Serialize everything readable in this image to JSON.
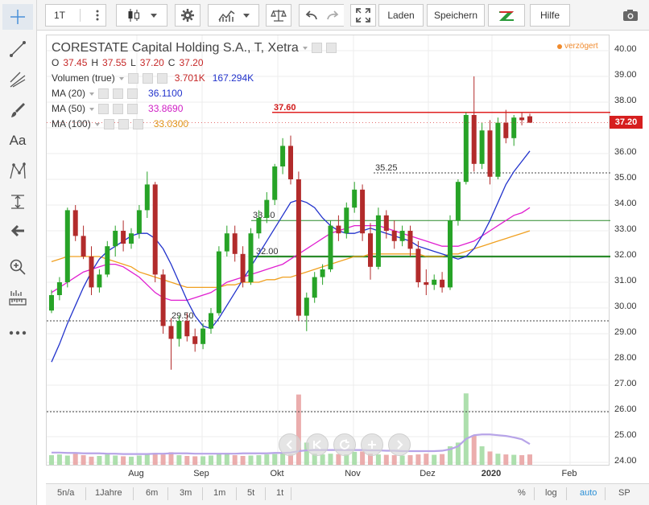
{
  "toolbar": {
    "interval": "1T",
    "load_label": "Laden",
    "save_label": "Speichern",
    "help_label": "Hilfe"
  },
  "legend": {
    "title": "CORESTATE Capital Holding S.A., T, Xetra",
    "o_label": "O",
    "o_value": "37.45",
    "h_label": "H",
    "h_value": "37.55",
    "l_label": "L",
    "l_value": "37.20",
    "c_label": "C",
    "c_value": "37.20",
    "volume_label": "Volumen (true)",
    "volume_v1": "3.701K",
    "volume_v2": "167.294K",
    "ma20_label": "MA (20)",
    "ma20_value": "36.1100",
    "ma50_label": "MA (50)",
    "ma50_value": "33.8690",
    "ma100_label": "MA (100)",
    "ma100_value": "33.0300",
    "delay": "verzögert"
  },
  "colors": {
    "up": "#27a327",
    "down": "#b22b2b",
    "ma20": "#2233cc",
    "ma50": "#e01fd0",
    "ma100": "#f0a020",
    "resistance": "#e02020",
    "support": "#2a8a2a",
    "vol_ma": "#b7a4e8"
  },
  "bottom": {
    "ranges": [
      "5n/a",
      "1Jahre",
      "6m",
      "3m",
      "1m",
      "5t",
      "1t"
    ],
    "percent": "%",
    "log": "log",
    "auto": "auto",
    "sp": "SP"
  },
  "chart_data": {
    "type": "candlestick",
    "yaxis": {
      "min": 24.0,
      "max": 40.0,
      "ticks": [
        "40.00",
        "39.00",
        "38.00",
        "37.00",
        "36.00",
        "35.00",
        "34.00",
        "33.00",
        "32.00",
        "31.00",
        "30.00",
        "29.00",
        "28.00",
        "27.00",
        "26.00",
        "25.00",
        "24.00"
      ]
    },
    "last_price": "37.20",
    "x_labels": [
      "Aug",
      "Sep",
      "Okt",
      "Nov",
      "Dez",
      "2020",
      "Feb"
    ],
    "candles": [
      [
        29.9,
        30.7,
        29.8,
        30.5
      ],
      [
        30.5,
        31.2,
        30.3,
        31.0
      ],
      [
        31.0,
        33.9,
        30.8,
        33.8
      ],
      [
        33.8,
        34.0,
        32.6,
        32.8
      ],
      [
        32.8,
        33.2,
        31.9,
        32.0
      ],
      [
        32.0,
        32.4,
        30.5,
        30.8
      ],
      [
        30.8,
        31.5,
        30.6,
        31.3
      ],
      [
        31.3,
        32.6,
        31.2,
        32.4
      ],
      [
        32.4,
        33.2,
        32.0,
        33.0
      ],
      [
        33.0,
        33.4,
        32.2,
        32.5
      ],
      [
        32.5,
        33.1,
        32.3,
        32.9
      ],
      [
        32.9,
        34.0,
        32.7,
        33.8
      ],
      [
        33.8,
        35.3,
        33.5,
        34.8
      ],
      [
        34.8,
        34.9,
        31.0,
        31.3
      ],
      [
        31.3,
        31.5,
        29.0,
        29.3
      ],
      [
        29.3,
        29.6,
        27.6,
        28.8
      ],
      [
        28.8,
        29.7,
        28.5,
        29.5
      ],
      [
        29.5,
        29.8,
        28.7,
        28.9
      ],
      [
        28.9,
        29.2,
        28.3,
        28.6
      ],
      [
        28.6,
        29.4,
        28.4,
        29.2
      ],
      [
        29.2,
        30.0,
        29.0,
        29.8
      ],
      [
        29.8,
        32.4,
        29.7,
        32.2
      ],
      [
        32.2,
        33.2,
        32.0,
        32.9
      ],
      [
        32.9,
        33.2,
        31.8,
        32.1
      ],
      [
        32.1,
        32.4,
        30.8,
        31.0
      ],
      [
        31.0,
        33.1,
        30.9,
        32.9
      ],
      [
        32.9,
        33.8,
        32.7,
        33.5
      ],
      [
        33.5,
        34.5,
        33.3,
        34.2
      ],
      [
        34.2,
        35.6,
        34.0,
        35.5
      ],
      [
        35.5,
        36.6,
        35.2,
        36.3
      ],
      [
        36.3,
        36.7,
        34.8,
        35.0
      ],
      [
        35.0,
        35.3,
        29.5,
        29.7
      ],
      [
        29.7,
        30.6,
        29.1,
        30.4
      ],
      [
        30.4,
        31.4,
        30.2,
        31.2
      ],
      [
        31.2,
        31.7,
        30.9,
        31.5
      ],
      [
        31.5,
        33.4,
        31.4,
        33.2
      ],
      [
        33.2,
        33.6,
        32.6,
        32.9
      ],
      [
        32.9,
        34.1,
        32.7,
        33.9
      ],
      [
        33.9,
        34.9,
        33.7,
        34.6
      ],
      [
        34.6,
        34.8,
        32.6,
        32.9
      ],
      [
        32.9,
        33.3,
        31.1,
        31.6
      ],
      [
        31.6,
        33.9,
        31.5,
        33.6
      ],
      [
        33.6,
        33.8,
        32.7,
        33.0
      ],
      [
        33.0,
        33.4,
        32.3,
        32.6
      ],
      [
        32.6,
        33.2,
        32.4,
        33.0
      ],
      [
        33.0,
        33.2,
        32.0,
        32.3
      ],
      [
        32.3,
        32.6,
        30.8,
        31.0
      ],
      [
        31.0,
        31.5,
        30.5,
        30.9
      ],
      [
        30.9,
        31.3,
        30.7,
        31.1
      ],
      [
        31.1,
        31.4,
        30.6,
        30.8
      ],
      [
        30.8,
        33.6,
        30.7,
        33.4
      ],
      [
        33.4,
        35.0,
        33.2,
        34.9
      ],
      [
        34.9,
        37.6,
        34.8,
        37.5
      ],
      [
        37.5,
        39.0,
        35.3,
        35.6
      ],
      [
        35.6,
        37.2,
        35.4,
        36.9
      ],
      [
        36.9,
        37.3,
        34.8,
        35.1
      ],
      [
        35.1,
        37.4,
        35.0,
        37.2
      ],
      [
        37.2,
        37.7,
        36.4,
        36.6
      ],
      [
        36.6,
        37.5,
        36.3,
        37.4
      ],
      [
        37.4,
        37.6,
        37.1,
        37.3
      ],
      [
        37.45,
        37.55,
        37.2,
        37.2
      ]
    ],
    "ma20": [
      27.9,
      28.6,
      29.4,
      30.1,
      30.8,
      31.4,
      31.9,
      32.2,
      32.4,
      32.6,
      32.8,
      32.9,
      32.9,
      32.7,
      32.3,
      31.7,
      31.0,
      30.3,
      29.7,
      29.3,
      29.2,
      29.6,
      30.1,
      30.6,
      31.1,
      31.6,
      32.1,
      32.6,
      33.1,
      33.6,
      34.1,
      34.2,
      34.1,
      33.9,
      33.5,
      33.2,
      33.0,
      32.9,
      32.9,
      33.0,
      33.1,
      33.0,
      32.9,
      32.8,
      32.7,
      32.6,
      32.4,
      32.3,
      32.2,
      32.1,
      32.0,
      31.9,
      32.0,
      32.3,
      32.8,
      33.4,
      34.1,
      34.8,
      35.3,
      35.7,
      36.1
    ],
    "ma50": [
      30.6,
      30.8,
      31.0,
      31.2,
      31.4,
      31.5,
      31.6,
      31.7,
      31.7,
      31.6,
      31.4,
      31.2,
      30.9,
      30.6,
      30.4,
      30.3,
      30.3,
      30.3,
      30.4,
      30.5,
      30.6,
      30.8,
      31.0,
      31.1,
      31.2,
      31.3,
      31.4,
      31.5,
      31.6,
      31.7,
      31.9,
      32.1,
      32.3,
      32.5,
      32.7,
      32.9,
      33.0,
      33.1,
      33.2,
      33.2,
      33.2,
      33.2,
      33.1,
      33.0,
      32.9,
      32.8,
      32.7,
      32.6,
      32.5,
      32.4,
      32.4,
      32.4,
      32.5,
      32.6,
      32.8,
      33.0,
      33.2,
      33.4,
      33.6,
      33.7,
      33.9
    ],
    "ma100": [
      31.8,
      31.9,
      32.0,
      32.0,
      32.0,
      32.0,
      32.0,
      31.9,
      31.8,
      31.7,
      31.6,
      31.4,
      31.3,
      31.2,
      31.1,
      31.0,
      30.9,
      30.8,
      30.8,
      30.8,
      30.8,
      30.8,
      30.9,
      30.9,
      31.0,
      31.0,
      31.0,
      31.1,
      31.1,
      31.2,
      31.2,
      31.3,
      31.4,
      31.5,
      31.6,
      31.7,
      31.8,
      31.9,
      32.0,
      32.0,
      32.1,
      32.1,
      32.1,
      32.1,
      32.1,
      32.1,
      32.1,
      32.0,
      32.0,
      32.0,
      32.1,
      32.1,
      32.2,
      32.3,
      32.4,
      32.5,
      32.6,
      32.7,
      32.8,
      32.9,
      33.0
    ],
    "volume": [
      2.6,
      2.8,
      2.5,
      3.0,
      2.6,
      2.2,
      2.4,
      2.8,
      2.5,
      2.3,
      2.2,
      2.5,
      2.7,
      3.2,
      2.8,
      3.4,
      2.6,
      2.4,
      2.3,
      2.3,
      2.5,
      3.0,
      3.2,
      2.6,
      2.4,
      2.5,
      2.6,
      2.8,
      2.9,
      3.1,
      2.8,
      19.0,
      6.0,
      3.0,
      2.8,
      3.0,
      2.9,
      2.8,
      3.5,
      3.6,
      3.0,
      2.8,
      2.7,
      2.6,
      2.5,
      2.6,
      2.8,
      3.0,
      2.7,
      2.9,
      5.0,
      6.0,
      19.3,
      8.0,
      5.0,
      3.6,
      3.0,
      2.8,
      2.7,
      2.6,
      2.8
    ],
    "volume_ma": [
      3.3,
      3.3,
      3.2,
      3.2,
      3.1,
      3.1,
      3.1,
      3.0,
      3.0,
      2.9,
      2.9,
      2.9,
      2.9,
      3.0,
      3.0,
      3.1,
      3.1,
      3.1,
      3.0,
      3.0,
      3.0,
      3.0,
      3.0,
      3.0,
      3.1,
      3.1,
      3.1,
      3.1,
      3.2,
      3.2,
      3.3,
      3.7,
      3.9,
      4.0,
      4.0,
      4.0,
      4.0,
      4.0,
      4.0,
      4.0,
      3.9,
      3.9,
      3.8,
      3.8,
      3.7,
      3.7,
      3.7,
      3.7,
      3.7,
      3.8,
      4.2,
      5.0,
      7.0,
      8.0,
      8.2,
      8.2,
      8.0,
      7.8,
      7.4,
      6.9,
      5.6
    ],
    "hlines": [
      {
        "value": 37.6,
        "label": "37.60",
        "style": "solid-red"
      },
      {
        "value": 35.25,
        "label": "35.25",
        "style": "dotted"
      },
      {
        "value": 33.4,
        "label": "33.40",
        "style": "solid-green"
      },
      {
        "value": 32.0,
        "label": "32.00",
        "style": "solid-green-thick"
      },
      {
        "value": 29.5,
        "label": "29.50",
        "style": "dotted"
      },
      {
        "value": 25.97,
        "label": "",
        "style": "dotted"
      }
    ]
  }
}
